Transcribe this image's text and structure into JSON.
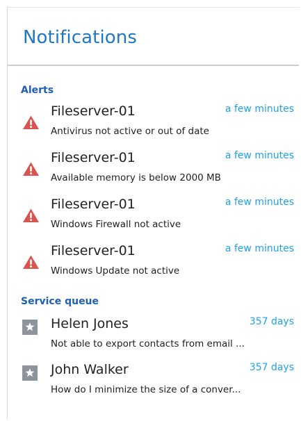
{
  "panel": {
    "title": "Notifications"
  },
  "alerts": {
    "title": "Alerts",
    "items": [
      {
        "name": "Fileserver-01",
        "time": "a few minutes",
        "description": "Antivirus not active or out of date",
        "icon": "warning-icon"
      },
      {
        "name": "Fileserver-01",
        "time": "a few minutes",
        "description": "Available memory is below 2000 MB",
        "icon": "warning-icon"
      },
      {
        "name": "Fileserver-01",
        "time": "a few minutes",
        "description": "Windows Firewall not active",
        "icon": "warning-icon"
      },
      {
        "name": "Fileserver-01",
        "time": "a few minutes",
        "description": "Windows Update not active",
        "icon": "warning-icon"
      }
    ]
  },
  "service_queue": {
    "title": "Service queue",
    "items": [
      {
        "name": "Helen Jones",
        "time": "357 days",
        "description": "Not able to export contacts from email ...",
        "icon": "star-icon"
      },
      {
        "name": "John Walker",
        "time": "357 days",
        "description": "How do I minimize the size of a conver...",
        "icon": "star-icon"
      }
    ]
  },
  "colors": {
    "title_blue": "#1e78c8",
    "section_blue": "#1e5fb8",
    "time_blue": "#1ea1ec",
    "warning_red": "#d9534f",
    "star_tile_gray": "#8e949b"
  }
}
